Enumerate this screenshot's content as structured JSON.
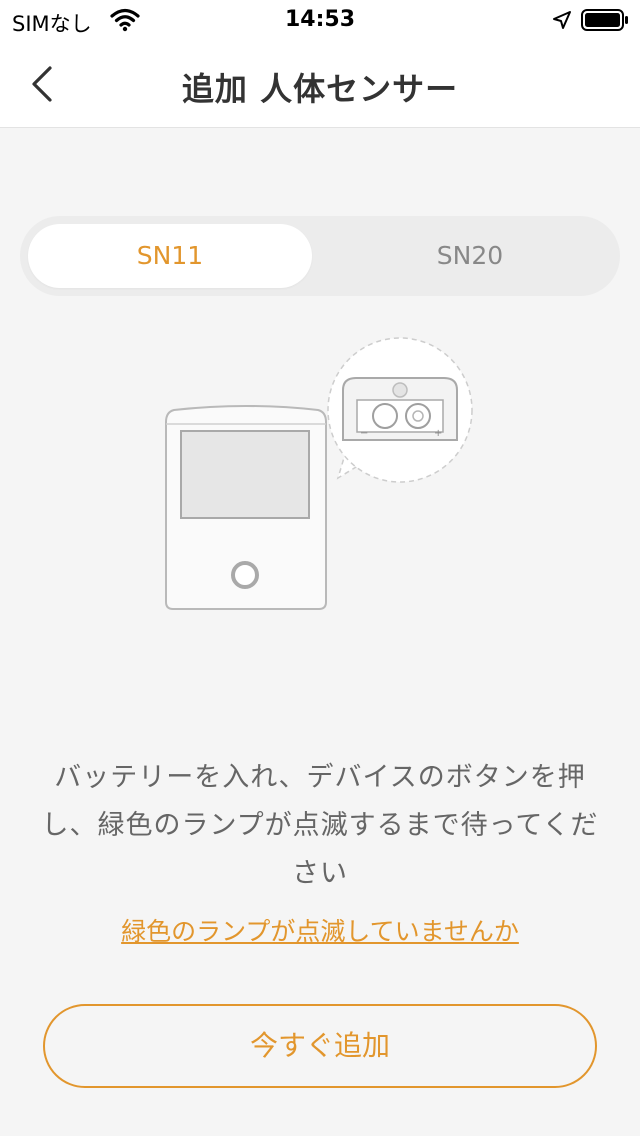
{
  "status_bar": {
    "carrier": "SIMなし",
    "time": "14:53"
  },
  "header": {
    "title": "追加 人体センサー"
  },
  "tabs": [
    {
      "label": "SN11",
      "selected": true
    },
    {
      "label": "SN20",
      "selected": false
    }
  ],
  "battery_polarity": {
    "minus": "−",
    "plus": "+"
  },
  "instruction": "バッテリーを入れ、デバイスのボタンを押し、緑色のランプが点滅するまで待ってください",
  "help_link": "緑色のランプが点滅していませんか",
  "add_button": "今すぐ追加",
  "colors": {
    "accent": "#e2962d",
    "background": "#f5f5f5"
  }
}
